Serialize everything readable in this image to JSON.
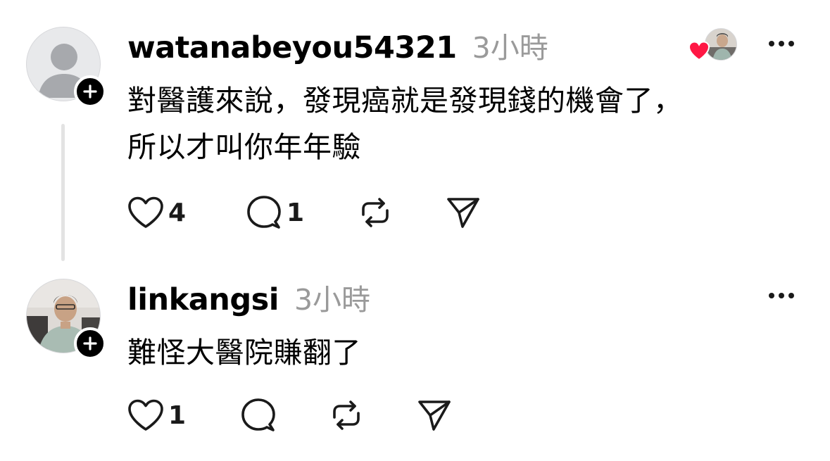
{
  "posts": [
    {
      "username": "watanabeyou54321",
      "time": "3小時",
      "text": "對醫護來說，發現癌就是發現錢的機會了，\n所以才叫你年年驗",
      "likes": "4",
      "replies": "1",
      "avatar_icon": "default-avatar",
      "liked_by_author": true
    },
    {
      "username": "linkangsi",
      "time": "3小時",
      "text": "難怪大醫院賺翻了",
      "likes": "1",
      "replies": "",
      "avatar_icon": "photo-avatar",
      "liked_by_author": false
    }
  ],
  "icons": {
    "like": "heart-outline-icon",
    "reply": "speech-bubble-icon",
    "repost": "repost-arrows-icon",
    "share": "paper-plane-icon",
    "more": "ellipsis-icon",
    "follow": "plus-icon"
  },
  "colors": {
    "text": "#000000",
    "secondary_text": "#9a9a9a",
    "icon": "#1a1a1a",
    "heart_red": "#ff1744",
    "thread_line": "#e3e3e3"
  }
}
